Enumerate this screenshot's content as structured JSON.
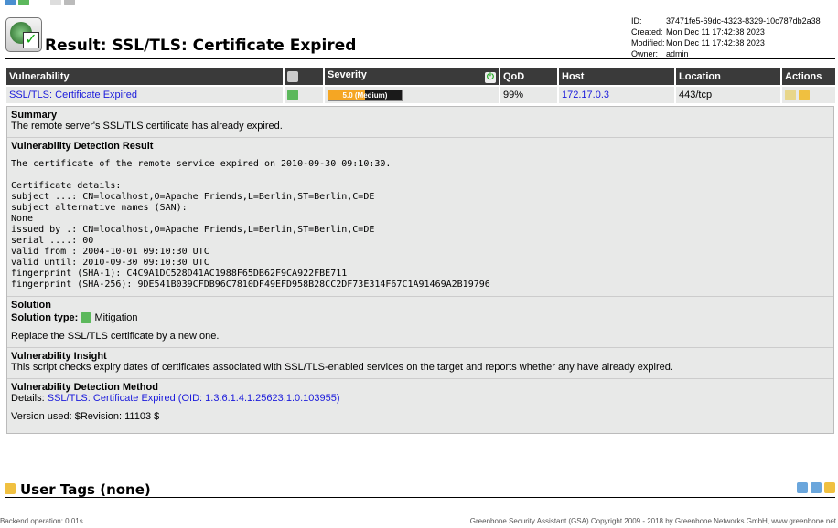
{
  "title": "Result: SSL/TLS: Certificate Expired",
  "meta": {
    "id_label": "ID:",
    "id": "37471fe5-69dc-4323-8329-10c787db2a38",
    "created_label": "Created:",
    "created": "Mon Dec 11 17:42:38 2023",
    "modified_label": "Modified:",
    "modified": "Mon Dec 11 17:42:38 2023",
    "owner_label": "Owner:",
    "owner": "admin"
  },
  "table": {
    "headers": {
      "vulnerability": "Vulnerability",
      "severity": "Severity",
      "qod": "QoD",
      "host": "Host",
      "location": "Location",
      "actions": "Actions"
    },
    "row": {
      "vulnerability": "SSL/TLS: Certificate Expired",
      "severity": "5.0 (Medium)",
      "severity_fraction": 0.5,
      "qod": "99%",
      "host": "172.17.0.3",
      "location": "443/tcp"
    }
  },
  "summary": {
    "title": "Summary",
    "text": "The remote server's SSL/TLS certificate has already expired."
  },
  "detection": {
    "title": "Vulnerability Detection Result",
    "text": "The certificate of the remote service expired on 2010-09-30 09:10:30.\n\nCertificate details:\nsubject ...: CN=localhost,O=Apache Friends,L=Berlin,ST=Berlin,C=DE\nsubject alternative names (SAN):\nNone\nissued by .: CN=localhost,O=Apache Friends,L=Berlin,ST=Berlin,C=DE\nserial ....: 00\nvalid from : 2004-10-01 09:10:30 UTC\nvalid until: 2010-09-30 09:10:30 UTC\nfingerprint (SHA-1): C4C9A1DC528D41AC1988F65DB62F9CA922FBE711\nfingerprint (SHA-256): 9DE541B039CFDB96C7810DF49EFD958B28CC2DF73E314F67C1A91469A2B19796"
  },
  "solution": {
    "title": "Solution",
    "type_label": "Solution type:",
    "type": "Mitigation",
    "text": "Replace the SSL/TLS certificate by a new one."
  },
  "insight": {
    "title": "Vulnerability Insight",
    "text": "This script checks expiry dates of certificates associated with SSL/TLS-enabled services on the target and reports whether any have already expired."
  },
  "method": {
    "title": "Vulnerability Detection Method",
    "details_label": "Details:",
    "details_link": "SSL/TLS: Certificate Expired (OID: 1.3.6.1.4.1.25623.1.0.103955)",
    "version": "Version used: $Revision: 11103 $"
  },
  "user_tags": {
    "title": "User Tags (none)"
  },
  "footer": {
    "left": "Backend operation: 0.01s",
    "right": "Greenbone Security Assistant (GSA) Copyright 2009 - 2018 by Greenbone Networks GmbH, www.greenbone.net"
  }
}
